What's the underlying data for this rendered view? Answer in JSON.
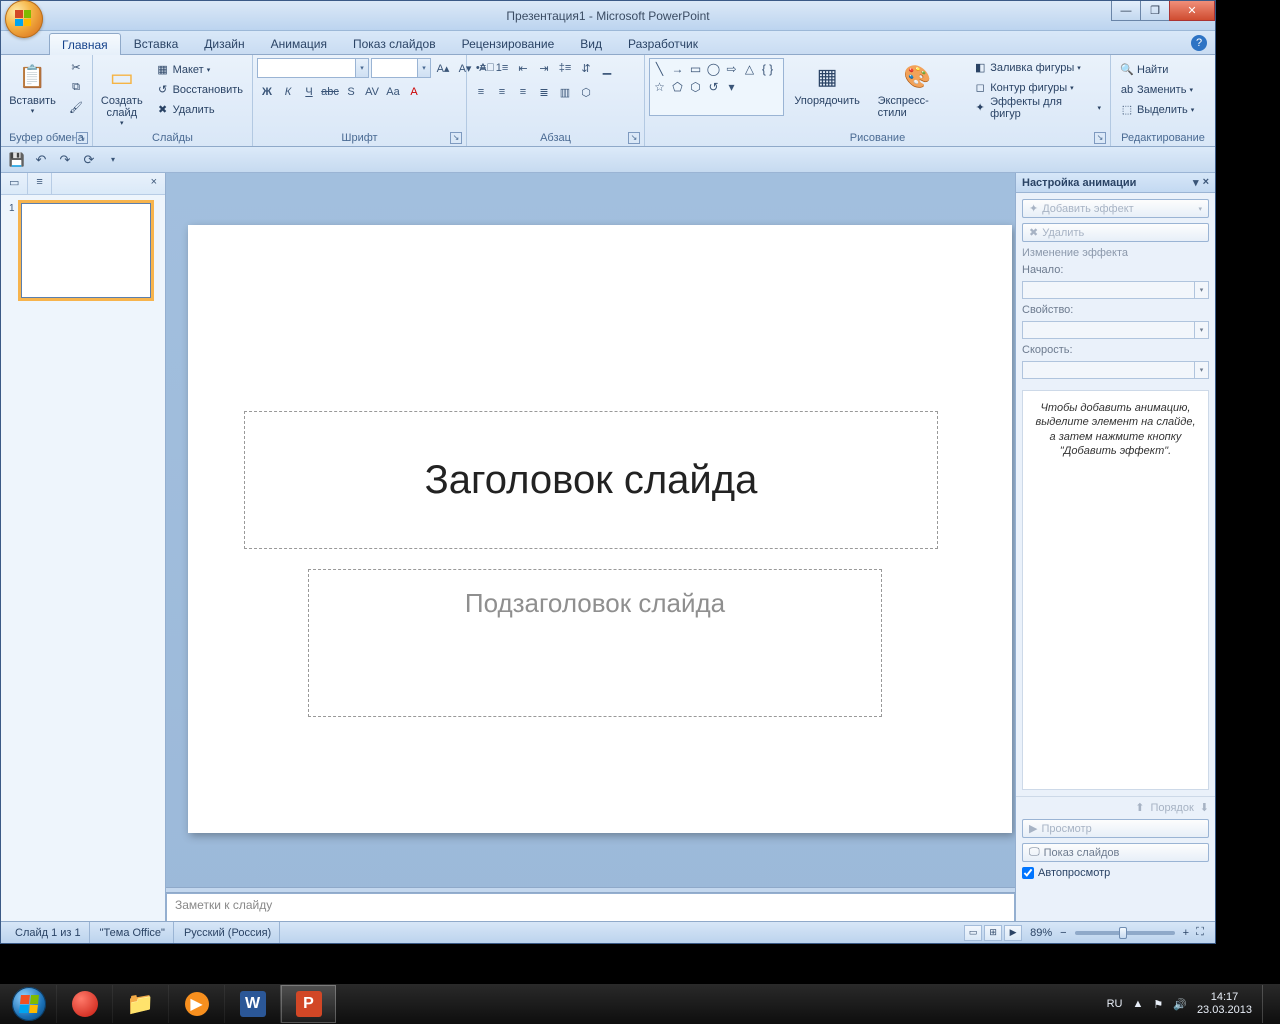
{
  "title": "Презентация1 - Microsoft PowerPoint",
  "tabs": [
    "Главная",
    "Вставка",
    "Дизайн",
    "Анимация",
    "Показ слайдов",
    "Рецензирование",
    "Вид",
    "Разработчик"
  ],
  "active_tab": 0,
  "ribbon": {
    "clipboard": {
      "label": "Буфер обмена",
      "paste": "Вставить"
    },
    "slides": {
      "label": "Слайды",
      "new": "Создать\nслайд",
      "layout": "Макет",
      "reset": "Восстановить",
      "delete": "Удалить"
    },
    "font": {
      "label": "Шрифт"
    },
    "paragraph": {
      "label": "Абзац"
    },
    "drawing": {
      "label": "Рисование",
      "arrange": "Упорядочить",
      "qstyles": "Экспресс-стили",
      "fill": "Заливка фигуры",
      "outline": "Контур фигуры",
      "effects": "Эффекты для фигур"
    },
    "editing": {
      "label": "Редактирование",
      "find": "Найти",
      "replace": "Заменить",
      "select": "Выделить"
    }
  },
  "slide_panel": {
    "thumb_num": "1"
  },
  "slide": {
    "title_ph": "Заголовок слайда",
    "subtitle_ph": "Подзаголовок слайда"
  },
  "notes": {
    "placeholder": "Заметки к слайду"
  },
  "task_pane": {
    "title": "Настройка анимации",
    "add_effect": "Добавить эффект",
    "remove": "Удалить",
    "change": "Изменение эффекта",
    "start": "Начало:",
    "property": "Свойство:",
    "speed": "Скорость:",
    "hint": "Чтобы добавить анимацию, выделите элемент на слайде, а затем нажмите кнопку \"Добавить эффект\".",
    "order": "Порядок",
    "preview": "Просмотр",
    "slideshow": "Показ слайдов",
    "autopreview": "Автопросмотр"
  },
  "status": {
    "slide": "Слайд 1 из 1",
    "theme": "\"Тема Office\"",
    "lang": "Русский (Россия)",
    "zoom": "89%"
  },
  "tray": {
    "lang": "RU",
    "time": "14:17",
    "date": "23.03.2013"
  }
}
